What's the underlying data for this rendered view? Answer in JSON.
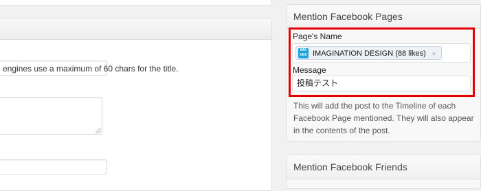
{
  "main": {
    "seo_description": "engines use a maximum of 60 chars for the title."
  },
  "mention_pages": {
    "title": "Mention Facebook Pages",
    "page_name_label": "Page's Name",
    "token_text": "IMAGINATION DESIGN (88 likes)",
    "token_logo_text": "IMA DES",
    "token_remove": "×",
    "message_label": "Message",
    "message_value": "投稿テスト",
    "help_text": "This will add the post to the Timeline of each Facebook Page mentioned. They will also appear in the contents of the post.",
    "highlight_color": "#e30000"
  },
  "mention_friends": {
    "title": "Mention Facebook Friends"
  }
}
